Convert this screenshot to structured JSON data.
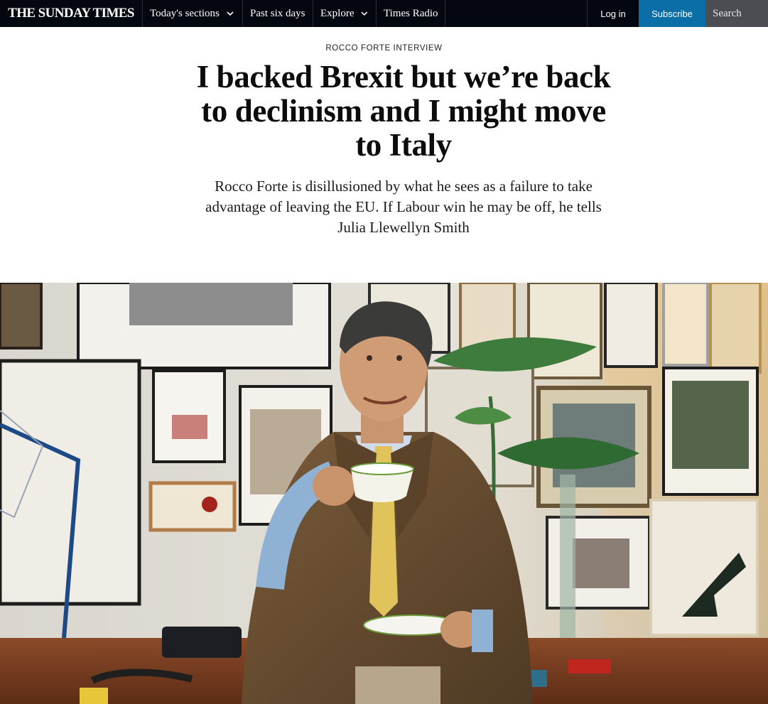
{
  "header": {
    "logo": "THE SUNDAY TIMES",
    "nav": {
      "todays_sections": "Today's sections",
      "past_six_days": "Past six days",
      "explore": "Explore",
      "times_radio": "Times Radio"
    },
    "login": "Log in",
    "subscribe": "Subscribe",
    "search_placeholder": "Search"
  },
  "article": {
    "kicker": "ROCCO FORTE INTERVIEW",
    "headline": "I backed Brexit but we’re back to declinism and I might move to Italy",
    "standfirst": "Rocco Forte is disillusioned by what he sees as a failure to take advantage of leaving the EU. If Labour win he may be off, he tells Julia Llewellyn Smith"
  },
  "colors": {
    "nav_background": "#04070f",
    "subscribe_blue": "#0b6ea6",
    "search_grey": "#4b4d53"
  },
  "icons": [
    "chevron-down-icon"
  ]
}
